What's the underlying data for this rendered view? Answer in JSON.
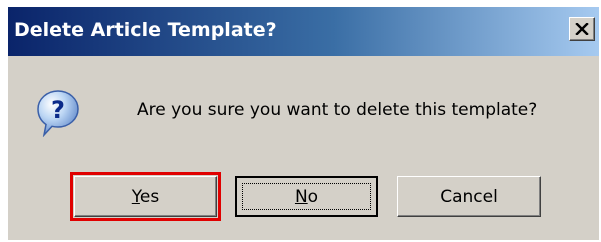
{
  "dialog": {
    "title": "Delete Article Template?",
    "close_label": "X",
    "message": "Are you sure you want to delete this template?",
    "icon": "question-icon",
    "buttons": {
      "yes": {
        "accel": "Y",
        "rest": "es"
      },
      "no": {
        "accel": "N",
        "rest": "o"
      },
      "cancel": {
        "label": "Cancel"
      }
    },
    "highlighted_button": "yes",
    "colors": {
      "title_bar_start": "#0a246a",
      "title_bar_end": "#a6caf0",
      "face": "#d4d0c8",
      "highlight": "#e00000"
    }
  }
}
